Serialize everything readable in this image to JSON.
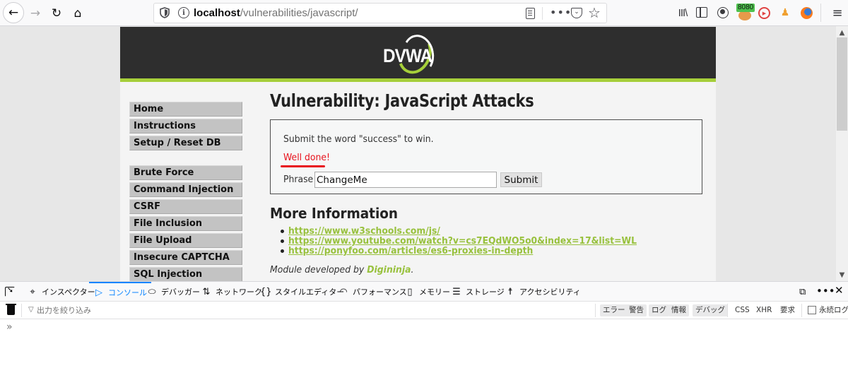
{
  "browser": {
    "url_host": "localhost",
    "url_path": "/vulnerabilities/javascript/",
    "proxy_badge": "8080",
    "icons": {
      "back": "back-arrow-icon",
      "forward": "forward-arrow-icon",
      "reload": "reload-icon",
      "home": "home-icon",
      "tracking": "shield-icon",
      "info": "info-icon",
      "reader": "reader-view-icon",
      "more": "more-icon",
      "pocket": "pocket-icon",
      "bookmark": "star-icon",
      "library": "library-icon",
      "sidebar": "sidebar-icon",
      "account": "account-icon",
      "proxy": "foxyproxy-icon",
      "youtube": "youtube-extension-icon",
      "extension": "extension-icon",
      "firefox": "firefox-icon",
      "menu": "hamburger-menu-icon"
    }
  },
  "site": {
    "logo_text": "DVWA",
    "menu_group1": [
      "Home",
      "Instructions",
      "Setup / Reset DB"
    ],
    "menu_group2": [
      "Brute Force",
      "Command Injection",
      "CSRF",
      "File Inclusion",
      "File Upload",
      "Insecure CAPTCHA",
      "SQL Injection"
    ]
  },
  "main": {
    "title": "Vulnerability: JavaScript Attacks",
    "instruction": "Submit the word \"success\" to win.",
    "result_message": "Well done!",
    "phrase_label": "Phrase",
    "phrase_value": "ChangeMe",
    "submit_label": "Submit",
    "more_info_heading": "More Information",
    "links": [
      "https://www.w3schools.com/js/",
      "https://www.youtube.com/watch?v=cs7EQdWO5o0&index=17&list=WL",
      "https://ponyfoo.com/articles/es6-proxies-in-depth"
    ],
    "credit_prefix": "Module developed by ",
    "credit_author": "Digininja",
    "credit_suffix": "."
  },
  "devtools": {
    "tabs": [
      {
        "label": "インスペクター",
        "icon": "inspector-icon"
      },
      {
        "label": "コンソール",
        "icon": "console-icon",
        "active": true
      },
      {
        "label": "デバッガー",
        "icon": "debugger-icon"
      },
      {
        "label": "ネットワーク",
        "icon": "network-icon"
      },
      {
        "label": "スタイルエディター",
        "icon": "style-editor-icon"
      },
      {
        "label": "パフォーマンス",
        "icon": "performance-icon"
      },
      {
        "label": "メモリー",
        "icon": "memory-icon"
      },
      {
        "label": "ストレージ",
        "icon": "storage-icon"
      },
      {
        "label": "アクセシビリティ",
        "icon": "accessibility-icon"
      }
    ],
    "filter_placeholder": "出力を絞り込み",
    "levels": [
      "エラー",
      "警告",
      "ログ",
      "情報",
      "デバッグ"
    ],
    "request_filters": [
      "CSS",
      "XHR",
      "要求"
    ],
    "persist_label": "永続ログ",
    "prompt": "»"
  }
}
